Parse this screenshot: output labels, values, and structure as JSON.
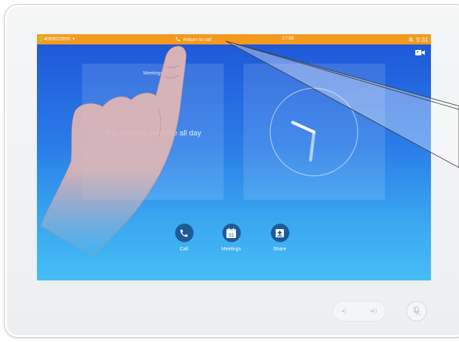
{
  "status_bar": {
    "phone_number": "4089023656",
    "dropdown_glyph": "▼",
    "return_to_call": "Return to call",
    "call_timer": "17:36",
    "clock_time": "9:31",
    "snow_glyph": "✻"
  },
  "meetings_panel": {
    "title": "Meetings",
    "message": "This room is available all day"
  },
  "actions": [
    {
      "label": "Call",
      "icon": "phone-icon"
    },
    {
      "label": "Meetings",
      "icon": "calendar-icon",
      "day": "31"
    },
    {
      "label": "Share",
      "icon": "share-upload-icon"
    }
  ],
  "hardware": {
    "volume_down_glyph": "◂)",
    "volume_up_glyph": "◂))",
    "mute_icon": "mic-mute-icon"
  },
  "colors": {
    "status_bar": "#f49a1e",
    "screen_top": "#1e55d6",
    "screen_bottom": "#45bdf5",
    "action_button": "#1d5a98"
  }
}
